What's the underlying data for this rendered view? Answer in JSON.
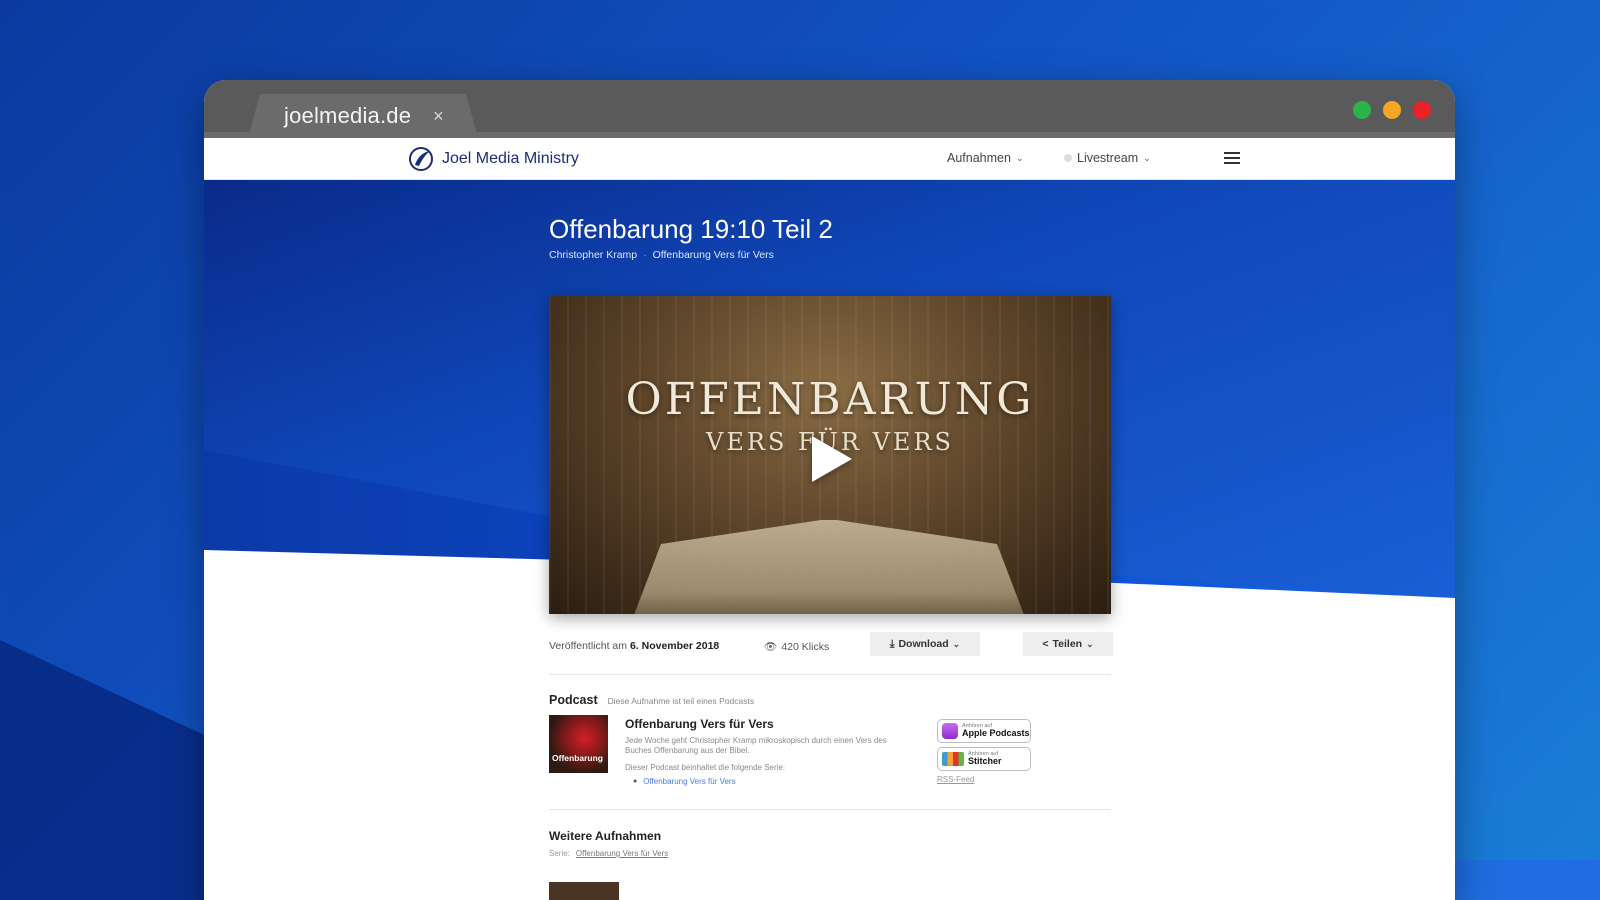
{
  "browser": {
    "tab_title": "joelmedia.de",
    "tab_close": "×"
  },
  "navbar": {
    "brand": "Joel Media Ministry",
    "links": [
      {
        "label": "Aufnahmen"
      },
      {
        "label": "Livestream"
      }
    ]
  },
  "recording": {
    "title": "Offenbarung 19:10 Teil 2",
    "speaker": "Christopher Kramp",
    "separator": "·",
    "series": "Offenbarung Vers für Vers",
    "video": {
      "title": "OFFENBARUNG",
      "subtitle": "VERS FÜR VERS"
    },
    "published_label": "Veröffentlicht am",
    "published_date": "6. November 2018",
    "views": "420 Klicks",
    "download_label": "Download",
    "share_label": "Teilen"
  },
  "podcast": {
    "heading": "Podcast",
    "note": "Diese Aufnahme ist teil eines Podcasts",
    "thumb_label": "Offenbarung",
    "title": "Offenbarung Vers für Vers",
    "description": "Jede Woche geht Christopher Kramp mikroskopisch durch einen Vers des Buches Offenbarung aus der Bibel.",
    "contains": "Dieser Podcast beinhaltet die folgende Serie:",
    "series": [
      "Offenbarung Vers für Vers"
    ],
    "badges": [
      {
        "small": "Anhören auf",
        "big": "Apple Podcasts"
      },
      {
        "small": "Anhören auf",
        "big": "Stitcher"
      }
    ],
    "rss": "RSS-Feed"
  },
  "more": {
    "heading": "Weitere Aufnahmen",
    "series_label": "Serie:",
    "series_link": "Offenbarung Vers für Vers"
  },
  "colors": {
    "brand": "#1b2d7a",
    "hero": "#0f47b8",
    "traffic_green": "#2bb44a",
    "traffic_yellow": "#f5a623",
    "traffic_red": "#ec2027"
  }
}
